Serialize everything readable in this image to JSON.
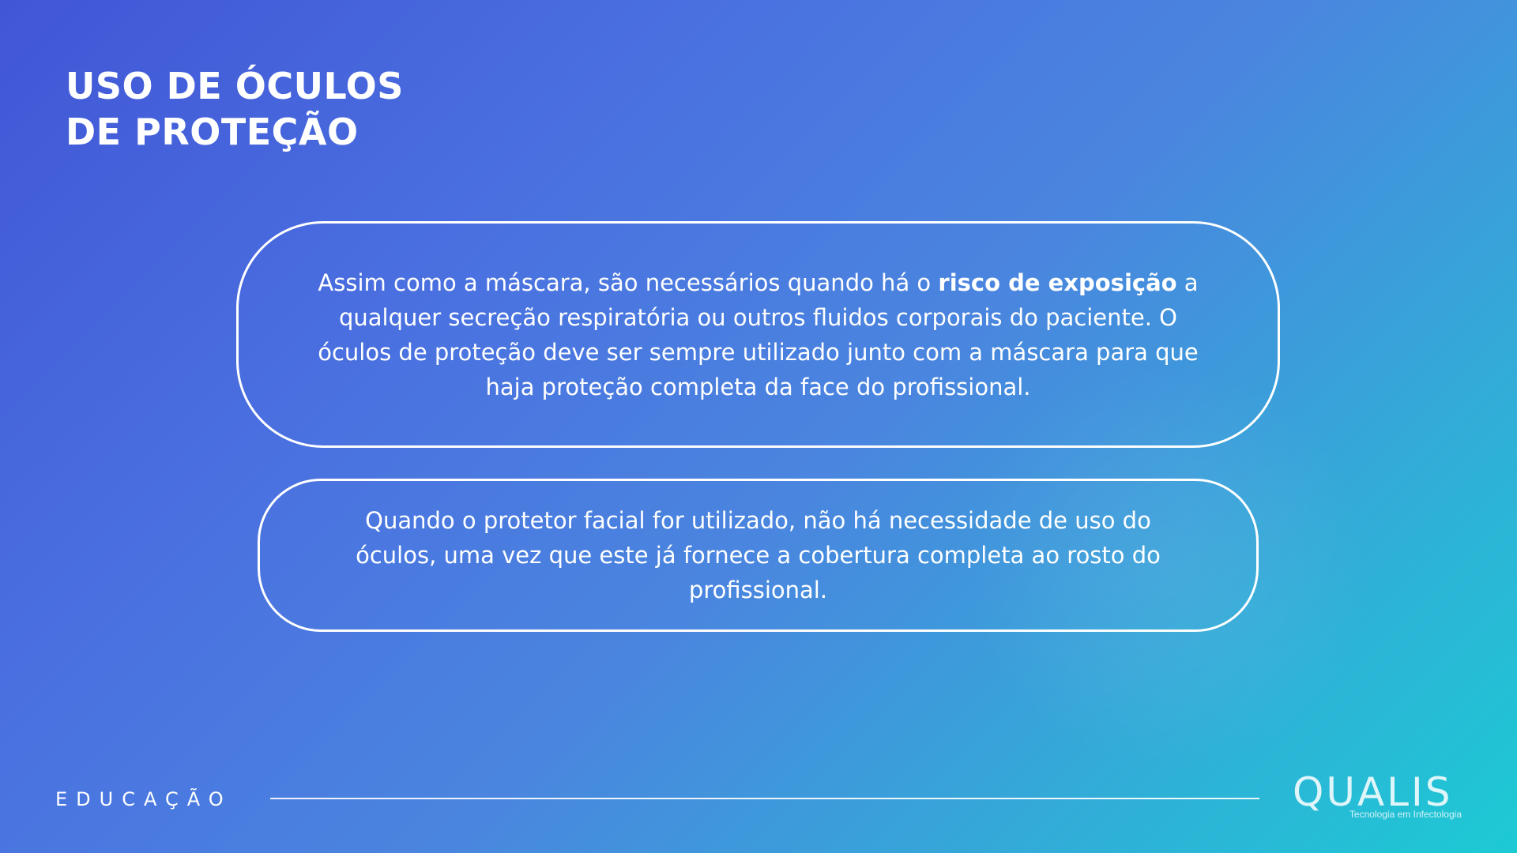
{
  "slide": {
    "title_line1": "USO DE ÓCULOS",
    "title_line2": "DE PROTEÇÃO"
  },
  "card1": {
    "text_before": "Assim como a máscara, são necessários quando há o ",
    "text_bold": "risco de exposição",
    "text_after": " a qualquer secreção respiratória ou outros fluidos corporais do paciente. O óculos de proteção deve ser sempre utilizado junto com a máscara para que haja proteção completa da face do profissional."
  },
  "card2": {
    "text": "Quando o protetor facial for utilizado, não há necessidade de uso do óculos, uma vez que este já fornece a cobertura completa ao rosto do profissional."
  },
  "footer": {
    "section_label": "EDUCAÇÃO",
    "logo_name": "QUALIS",
    "logo_tagline": "Tecnologia em Infectologia"
  },
  "colors": {
    "background_start": "#4156d6",
    "background_end": "#1ccad4",
    "text": "#ffffff"
  }
}
